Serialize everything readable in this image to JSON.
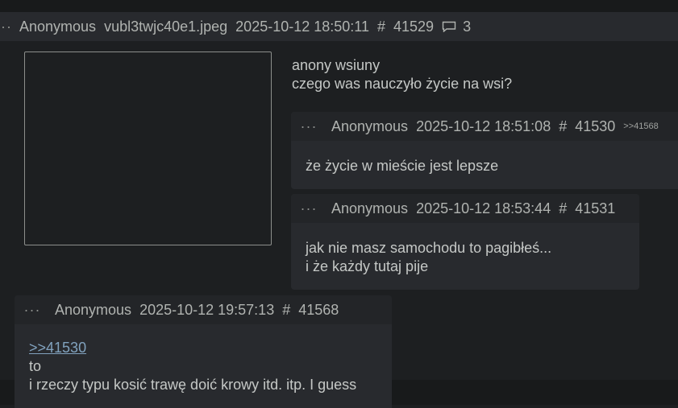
{
  "op": {
    "menu": "···",
    "name": "Anonymous",
    "filename": "vubl3twjc40e1.jpeg",
    "date": "2025-10-12 18:50:11",
    "hash": "#",
    "post_no": "41529",
    "reply_count": "3",
    "text_line1": "anony wsiuny",
    "text_line2": "czego was nauczyło życie na wsi?"
  },
  "replies": [
    {
      "menu": "···",
      "name": "Anonymous",
      "date": "2025-10-12 18:51:08",
      "hash": "#",
      "post_no": "41530",
      "backlink": ">>41568",
      "line1": "że życie w mieście jest lepsze"
    },
    {
      "menu": "···",
      "name": "Anonymous",
      "date": "2025-10-12 18:53:44",
      "hash": "#",
      "post_no": "41531",
      "line1": "jak nie masz samochodu to pagibłeś...",
      "line2": "i że każdy tutaj pije"
    },
    {
      "menu": "···",
      "name": "Anonymous",
      "date": "2025-10-12 19:57:13",
      "hash": "#",
      "post_no": "41568",
      "quote_link": ">>41530",
      "line1": "to",
      "line2": "i rzeczy typu kosić trawę doić krowy itd. itp. I guess"
    }
  ],
  "colors": {
    "background": "#1d1f21",
    "post_background": "#282a2e",
    "text": "#c5c8c6",
    "link": "#81a2be"
  }
}
